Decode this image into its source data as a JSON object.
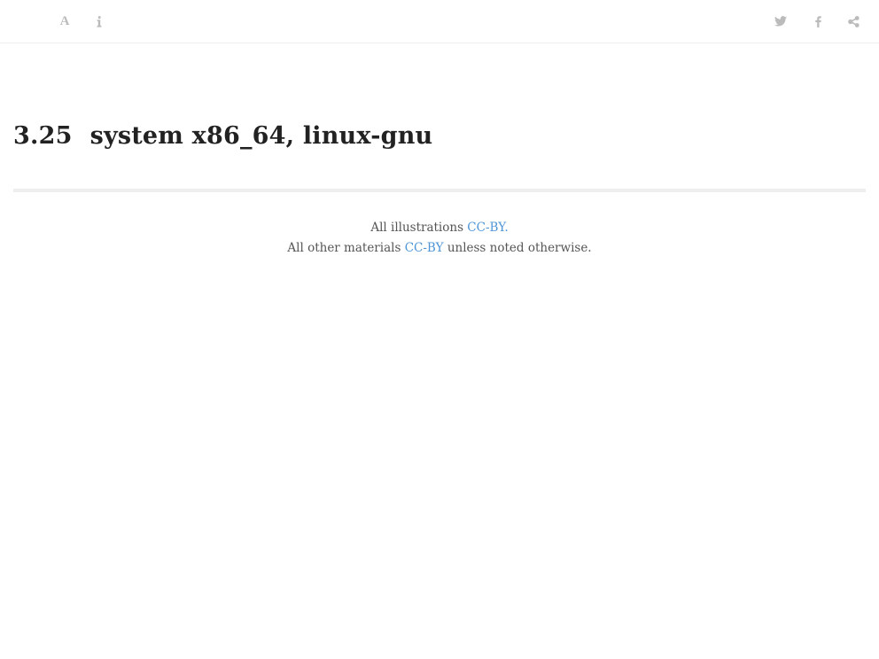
{
  "toolbar": {
    "left_icons": [
      "font-settings-icon",
      "info-icon"
    ],
    "right_icons": [
      "twitter-icon",
      "facebook-icon",
      "share-icon"
    ],
    "font_button_glyph": "A",
    "icon_color": "#bbbbbb"
  },
  "main": {
    "section_number": "3.25",
    "section_title": "system x86_64, linux-gnu"
  },
  "footer": {
    "line1_prefix": "All illustrations",
    "line1_link": "CC-BY.",
    "line2_prefix": "All other materials",
    "line2_link": "CC-BY",
    "line2_suffix": "unless noted otherwise.",
    "link_color": "#4d95d6"
  }
}
